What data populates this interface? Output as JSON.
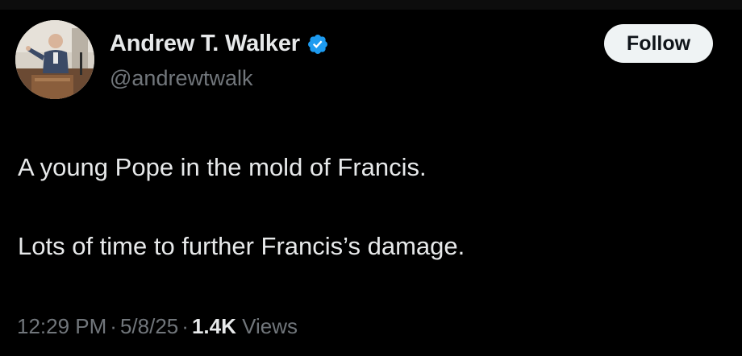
{
  "author": {
    "display_name": "Andrew T. Walker",
    "handle": "@andrewtwalk",
    "verified_icon": "verified-badge-icon",
    "verified_color": "#1d9bf0"
  },
  "actions": {
    "follow_label": "Follow"
  },
  "tweet": {
    "lines": [
      "A young Pope in the mold of Francis.",
      "Lots of time to further Francis’s damage."
    ]
  },
  "meta": {
    "time": "12:29 PM",
    "separator": "·",
    "date": "5/8/25",
    "views_count": "1.4K",
    "views_label": "Views"
  },
  "colors": {
    "background": "#000000",
    "text_primary": "#e7e9ea",
    "text_secondary": "#71767b",
    "button_bg": "#eff3f4"
  }
}
